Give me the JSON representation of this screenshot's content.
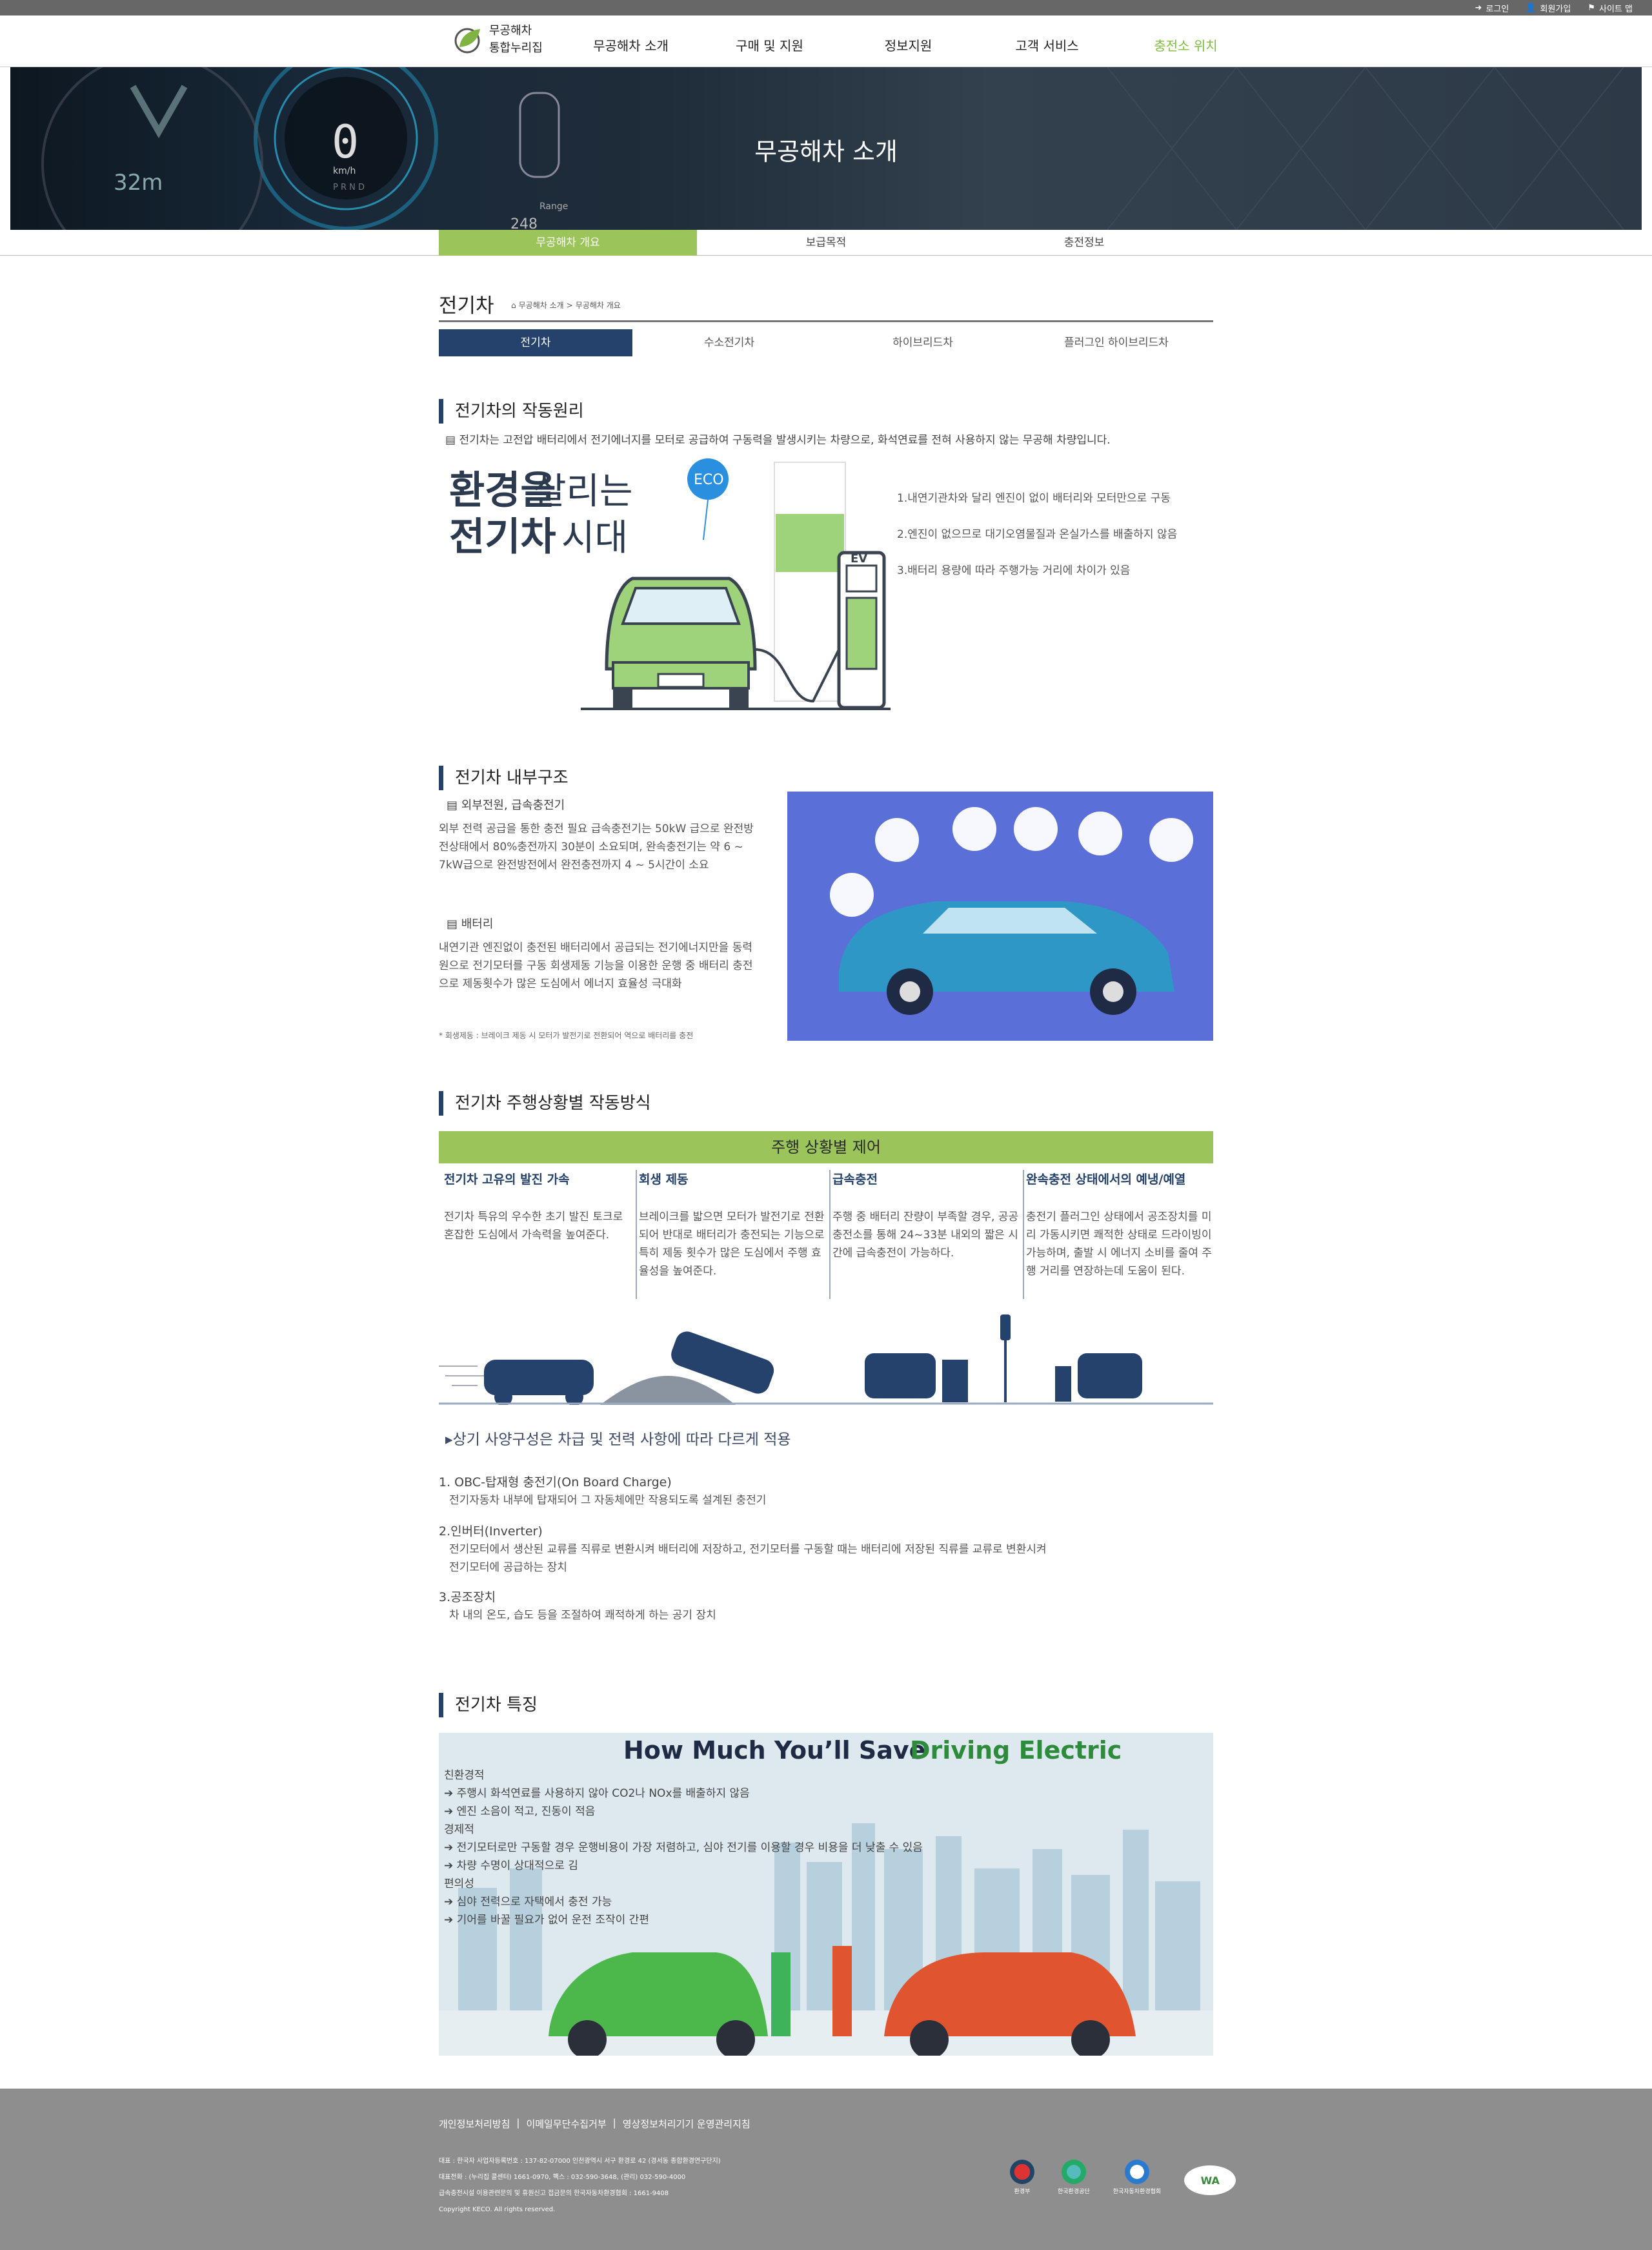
{
  "topbar": {
    "login": "로그인",
    "join": "회원가입",
    "sitemap": "사이트 맵"
  },
  "logo": {
    "line1": "무공해차",
    "line2": "통합누리집"
  },
  "gnb": [
    "무공해차 소개",
    "구매 및 지원",
    "정보지원",
    "고객 서비스",
    "충전소 위치"
  ],
  "hero": {
    "title": "무공해차 소개",
    "cluster_speed": "0",
    "cluster_unit": "km/h",
    "cluster_gear": "P R N D",
    "cluster_range": "Range",
    "cluster_km": "32m",
    "cluster_range_val": "248"
  },
  "subnav": [
    "무공해차 개요",
    "보급목적",
    "충전정보"
  ],
  "page": {
    "title": "전기차",
    "breadcrumb": [
      "무공해차 소개",
      "무공해차 개요"
    ]
  },
  "tabs": [
    "전기차",
    "수소전기차",
    "하이브리드차",
    "플러그인 하이브리드차"
  ],
  "section1": {
    "title": "전기차의 작동원리",
    "intro": "전기차는 고전압 배터리에서 전기에너지를 모터로 공급하여 구동력을 발생시키는 차량으로, 화석연료를 전혀 사용하지 않는 무공해 차량입니다.",
    "banner_line1a": "환경을",
    "banner_line1b": " 살리는",
    "banner_line2a": "전기차",
    "banner_line2b": " 시대",
    "eco": "ECO",
    "ev": "EV",
    "points": [
      "1.내연기관차와 달리 엔진이 없이 배터리와 모터만으로 구동",
      "2.엔진이 없으므로 대기오염물질과 온실가스를 배출하지 않음",
      "3.배터리 용량에 따라 주행가능 거리에 차이가 있음"
    ]
  },
  "section2": {
    "title": "전기차 내부구조",
    "item1_title": "외부전원, 급속충전기",
    "item1_text": "외부 전력 공급을 통한 충전 필요 급속충전기는 50kW 급으로 완전방전상태에서 80%충전까지 30분이 소요되며, 완속충전기는 약 6 ~ 7kW급으로 완전방전에서 완전충전까지 4 ~ 5시간이 소요",
    "item2_title": "배터리",
    "item2_text": "내연기관 엔진없이 충전된 배터리에서 공급되는 전기에너지만을 동력원으로 전기모터를 구동 회생제동 기능을 이용한 운행 중 배터리 충전으로 제동횟수가 많은 도심에서 에너지 효율성 극대화",
    "note": "* 회생제동 : 브레이크 제동 시 모터가 발전기로 전환되어 역으로 배터리를 충전"
  },
  "section3": {
    "title": "전기차 주행상황별 작동방식",
    "bar": "주행 상황별 제어",
    "cols": [
      {
        "h": "전기차 고유의 발진 가속",
        "t": "전기차 특유의 우수한 초기 발진 토크로 혼잡한 도심에서 가속력을 높여준다."
      },
      {
        "h": "회생 제동",
        "t": "브레이크를 밟으면 모터가 발전기로 전환되어 반대로 배터리가 충전되는 기능으로 특히 제동 횟수가 많은 도심에서 주행 효율성을 높여준다."
      },
      {
        "h": "급속충전",
        "t": "주행 중 배터리 잔량이 부족할 경우, 공공 충전소를 통해 24~33분 내외의 짧은 시간에 급속충전이 가능하다."
      },
      {
        "h": "완속충전 상태에서의 예냉/예열",
        "t": "충전기 플러그인 상태에서 공조장치를 미리 가동시키면 쾌적한 상태로 드라이빙이 가능하며, 출발 시 에너지 소비를 줄여 주행 거리를 연장하는데 도움이 된다."
      }
    ],
    "spec_title": "상기 사양구성은 차급 및 전력 사항에 따라 다르게 적용",
    "specs": [
      {
        "h": "1. OBC-탑재형 충전기(On Board Charge)",
        "t1": "전기자동차 내부에 탑재되어 그 자동체에만 작용되도록 설계된 충전기",
        "t2": ""
      },
      {
        "h": "2.인버터(Inverter)",
        "t1": "전기모터에서 생산된 교류를 직류로 변환시켜 배터리에 저장하고, 전기모터를 구동할 때는 배터리에 저장된 직류를 교류로 변환시켜",
        "t2": "전기모터에 공급하는 장치"
      },
      {
        "h": "3.공조장치",
        "t1": "차 내의 온도, 습도 등을 조절하여 쾌적하게 하는 공기 장치",
        "t2": ""
      }
    ]
  },
  "section4": {
    "title": "전기차 특징",
    "headline_a": "How Much You’ll Save ",
    "headline_b": "Driving Electric",
    "groups": [
      {
        "h": "친환경적",
        "items": [
          "주행시 화석연료를 사용하지 않아 CO2나 NOx를 배출하지 않음",
          "엔진 소음이 적고, 진동이 적음"
        ]
      },
      {
        "h": "경제적",
        "items": [
          "전기모터로만 구동할 경우 운행비용이 가장 저렴하고, 심야 전기를 이용할 경우 비용을 더 낮출 수 있음",
          "차량 수명이 상대적으로 김"
        ]
      },
      {
        "h": "편의성",
        "items": [
          "심야 전력으로 자택에서 충전 가능",
          "기어를 바꿀 필요가 없어 운전 조작이 간편"
        ]
      }
    ]
  },
  "footer": {
    "links": [
      "개인정보처리방침",
      "이메일무단수집거부",
      "영상정보처리기기 운영관리지침"
    ],
    "info": [
      "대표 : 한국자 사업자등록번호 : 137-82-07000 인천광역시 서구 환경로 42 (경서동 종합환경연구단지)",
      "대표전화 : (누리집 콜센터) 1661-0970, 팩스 : 032-590-3648, (관리) 032-590-4000",
      "급속충전시설 이용관련문의 및 휴원신고 접금문의 한국자동차환경협회 : 1661-9408",
      "Copyright KECO. All rights reserved."
    ],
    "logos": [
      "환경부",
      "한국환경공단",
      "한국자동차환경협회",
      "WA"
    ]
  },
  "colors": {
    "accent_green": "#9bc45b",
    "navy": "#24426b",
    "gnb_active": "#7fbc41",
    "footer": "#8e8e8e"
  }
}
